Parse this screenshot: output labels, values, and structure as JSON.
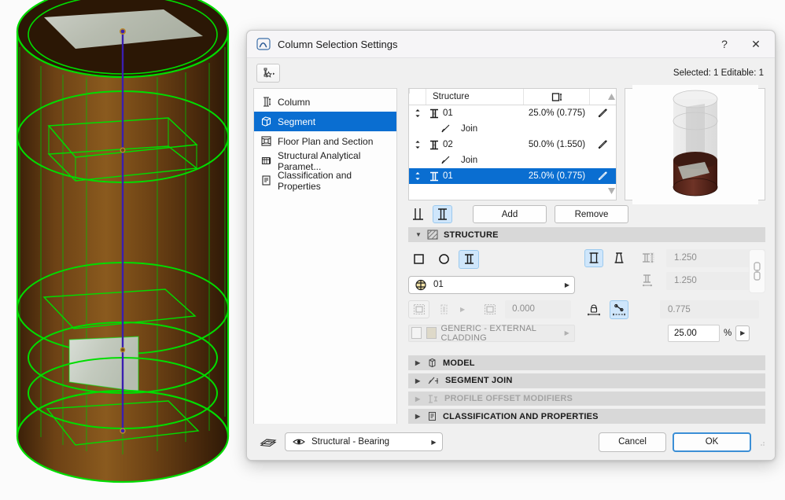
{
  "window": {
    "title": "Column Selection Settings",
    "icon": "archicad-logo-icon",
    "help_label": "?",
    "close_label": "✕",
    "favorites_icon": "favorites-star-icon",
    "selection_info": "Selected: 1 Editable: 1"
  },
  "sidebar": {
    "items": [
      {
        "label": "Column",
        "icon": "column-icon",
        "selected": false
      },
      {
        "label": "Segment",
        "icon": "segment-box-icon",
        "selected": true
      },
      {
        "label": "Floor Plan and Section",
        "icon": "floor-plan-icon",
        "selected": false
      },
      {
        "label": "Structural Analytical Paramet...",
        "icon": "structural-analytical-icon",
        "selected": false
      },
      {
        "label": "Classification and Properties",
        "icon": "classification-icon",
        "selected": false
      }
    ]
  },
  "segment_list": {
    "columns": [
      "",
      "Structure",
      "height-icon",
      ""
    ],
    "header_structure": "Structure",
    "rows": [
      {
        "type": "segment",
        "name": "01",
        "value": "25.0% (0.775)",
        "selected": false
      },
      {
        "type": "join",
        "name": "Join",
        "value": "",
        "selected": false
      },
      {
        "type": "segment",
        "name": "02",
        "value": "50.0% (1.550)",
        "selected": false
      },
      {
        "type": "join",
        "name": "Join",
        "value": "",
        "selected": false
      },
      {
        "type": "segment",
        "name": "01",
        "value": "25.0% (0.775)",
        "selected": true
      }
    ]
  },
  "list_toolbar": {
    "toggle_simple": "simple-column-icon",
    "toggle_profiled": "profiled-column-icon",
    "add_label": "Add",
    "remove_label": "Remove"
  },
  "sections": {
    "structure": {
      "label": "STRUCTURE",
      "expanded": true,
      "icon": "hatch-icon",
      "enabled": true
    },
    "model": {
      "label": "MODEL",
      "expanded": false,
      "icon": "model-box-icon",
      "enabled": true
    },
    "segment_join": {
      "label": "SEGMENT JOIN",
      "expanded": false,
      "icon": "segment-join-icon",
      "enabled": true
    },
    "profile_offset": {
      "label": "PROFILE OFFSET MODIFIERS",
      "expanded": false,
      "icon": "profile-offset-icon",
      "enabled": false
    },
    "classification": {
      "label": "CLASSIFICATION AND PROPERTIES",
      "expanded": false,
      "icon": "classification-icon",
      "enabled": true
    }
  },
  "structure": {
    "shape_rectangular": "rectangular-shape-icon",
    "shape_circular": "circular-shape-icon",
    "shape_profiled": "profiled-shape-icon",
    "selected_shape": "profiled",
    "profile_value": "01",
    "profile_icon": "profile-swatch-icon",
    "core_btn_icon": "core-skin-icon",
    "veneer_btn_icon": "veneer-icon",
    "veneer_thickness_icon": "veneer-thickness-icon",
    "veneer_thickness": "0.000",
    "material": "GENERIC - EXTERNAL CLADDING",
    "taper_straight_icon": "straight-column-icon",
    "taper_tapered_icon": "tapered-column-icon",
    "selected_taper": "straight",
    "width_icon": "profile-width-icon",
    "width_value": "1.250",
    "depth_icon": "profile-depth-icon",
    "depth_value": "1.250",
    "link_icon": "link-chain-icon",
    "fixed_icon": "fixed-length-lock-icon",
    "percent_icon": "percent-length-icon",
    "selected_length_mode": "percent",
    "length_value": "0.775",
    "percent_value": "25.00",
    "percent_symbol": "%",
    "stepper_icon": "stepper-arrow-icon"
  },
  "preview": {
    "label": "3d-preview-thumbnail"
  },
  "footer": {
    "layers_icon": "layers-icon",
    "visibility_icon": "eye-icon",
    "layer_value": "Structural - Bearing",
    "cancel_label": "Cancel",
    "ok_label": "OK"
  },
  "colors": {
    "accent": "#0a6ed1",
    "toggle_on_bg": "#cfe6fb",
    "section_header_bg": "#d8d8d8",
    "dialog_bg": "#f0f0f0",
    "ok_border": "#3b8fd6",
    "viewport_wood": "#6b3f16",
    "viewport_outline": "#00e000",
    "viewport_axis": "#3a1fb0"
  }
}
